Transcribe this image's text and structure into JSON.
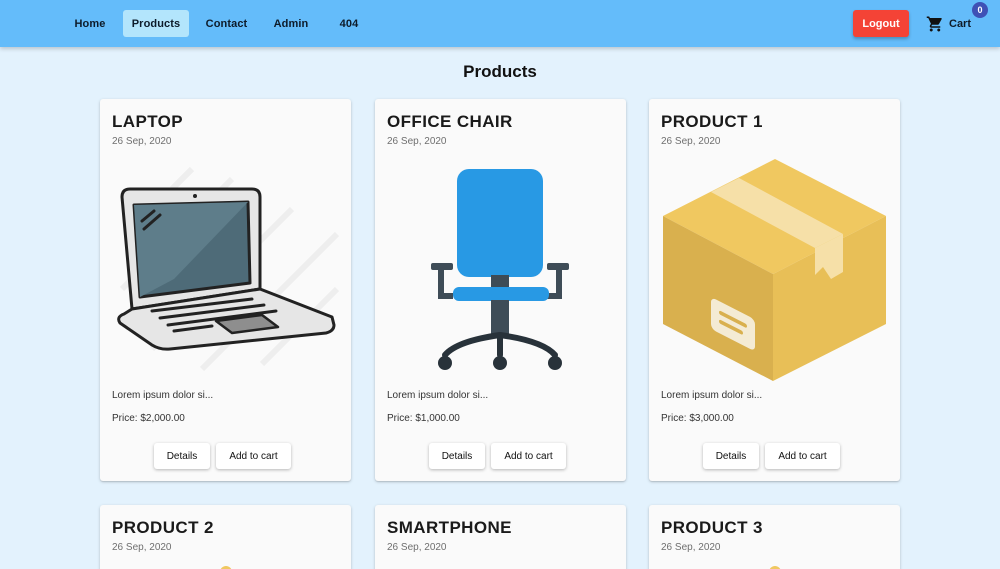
{
  "nav": {
    "items": [
      {
        "label": "Home"
      },
      {
        "label": "Products"
      },
      {
        "label": "Contact"
      },
      {
        "label": "Admin"
      },
      {
        "label": "404"
      }
    ],
    "active": "Products",
    "logout_label": "Logout",
    "cart_label": "Cart",
    "cart_count": "0",
    "cart_icon": "shopping-cart-icon"
  },
  "page": {
    "title": "Products"
  },
  "products": [
    {
      "name": "LAPTOP",
      "date": "26 Sep, 2020",
      "image": "laptop-icon",
      "description": "Lorem ipsum dolor si...",
      "price": "Price: $2,000.00",
      "details_label": "Details",
      "add_label": "Add to cart"
    },
    {
      "name": "OFFICE CHAIR",
      "date": "26 Sep, 2020",
      "image": "office-chair-icon",
      "description": "Lorem ipsum dolor si...",
      "price": "Price: $1,000.00",
      "details_label": "Details",
      "add_label": "Add to cart"
    },
    {
      "name": "PRODUCT 1",
      "date": "26 Sep, 2020",
      "image": "box-icon",
      "description": "Lorem ipsum dolor si...",
      "price": "Price: $3,000.00",
      "details_label": "Details",
      "add_label": "Add to cart"
    },
    {
      "name": "PRODUCT 2",
      "date": "26 Sep, 2020"
    },
    {
      "name": "SMARTPHONE",
      "date": "26 Sep, 2020"
    },
    {
      "name": "PRODUCT 3",
      "date": "26 Sep, 2020"
    }
  ],
  "colors": {
    "appbar": "#64bcfa",
    "background": "#e3f2fd",
    "active_nav": "#b3e5fc",
    "logout": "#f44336",
    "badge": "#3f51b5"
  }
}
